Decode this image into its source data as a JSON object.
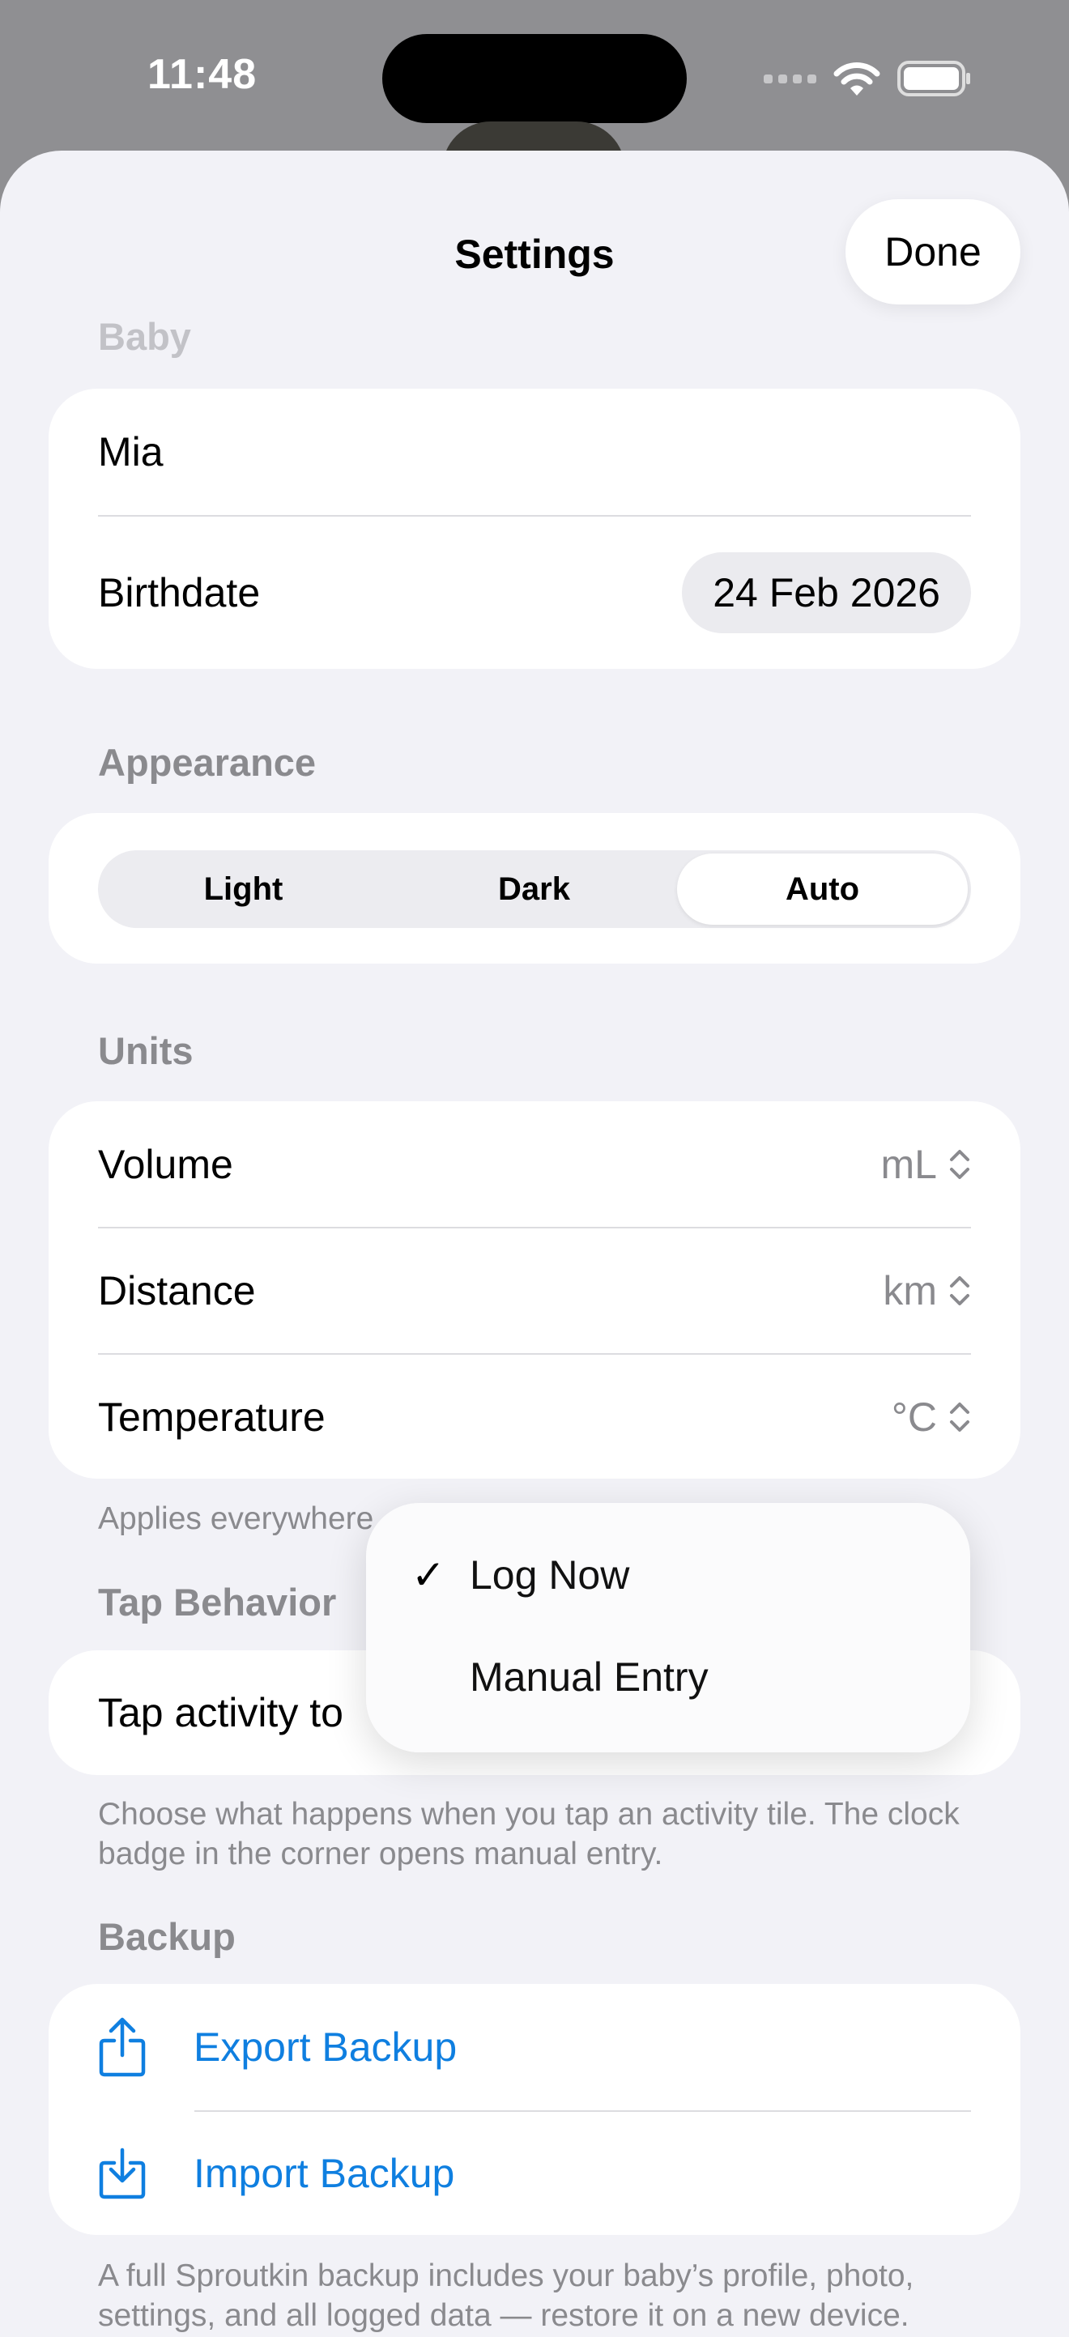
{
  "status_bar": {
    "time": "11:48"
  },
  "nav": {
    "title": "Settings",
    "done_label": "Done"
  },
  "baby": {
    "header": "Baby",
    "name": "Mia",
    "birthdate_label": "Birthdate",
    "birthdate_value": "24 Feb 2026"
  },
  "appearance": {
    "header": "Appearance",
    "options": [
      "Light",
      "Dark",
      "Auto"
    ],
    "selected": "Auto"
  },
  "units": {
    "header": "Units",
    "rows": [
      {
        "label": "Volume",
        "value": "mL"
      },
      {
        "label": "Distance",
        "value": "km"
      },
      {
        "label": "Temperature",
        "value": "°C"
      }
    ],
    "footer": "Applies everywhere"
  },
  "tap_behavior": {
    "header": "Tap Behavior",
    "row_label": "Tap activity to",
    "footer": "Choose what happens when you tap an activity tile. The clock badge in the corner opens manual entry."
  },
  "dropdown": {
    "items": [
      {
        "label": "Log Now",
        "checked": true
      },
      {
        "label": "Manual Entry",
        "checked": false
      }
    ],
    "check_glyph": "✓"
  },
  "backup": {
    "header": "Backup",
    "export_label": "Export Backup",
    "import_label": "Import Backup",
    "footer": "A full Sproutkin backup includes your baby’s profile, photo, settings, and all logged data — restore it on a new device."
  },
  "colors": {
    "accent": "#0F7FE0",
    "background": "#F2F2F7",
    "secondary_text": "#8A8A8E"
  },
  "icons": [
    "wifi-icon",
    "battery-icon",
    "chevron-updown-icon",
    "share-export-icon",
    "import-tray-icon",
    "checkmark-icon"
  ]
}
